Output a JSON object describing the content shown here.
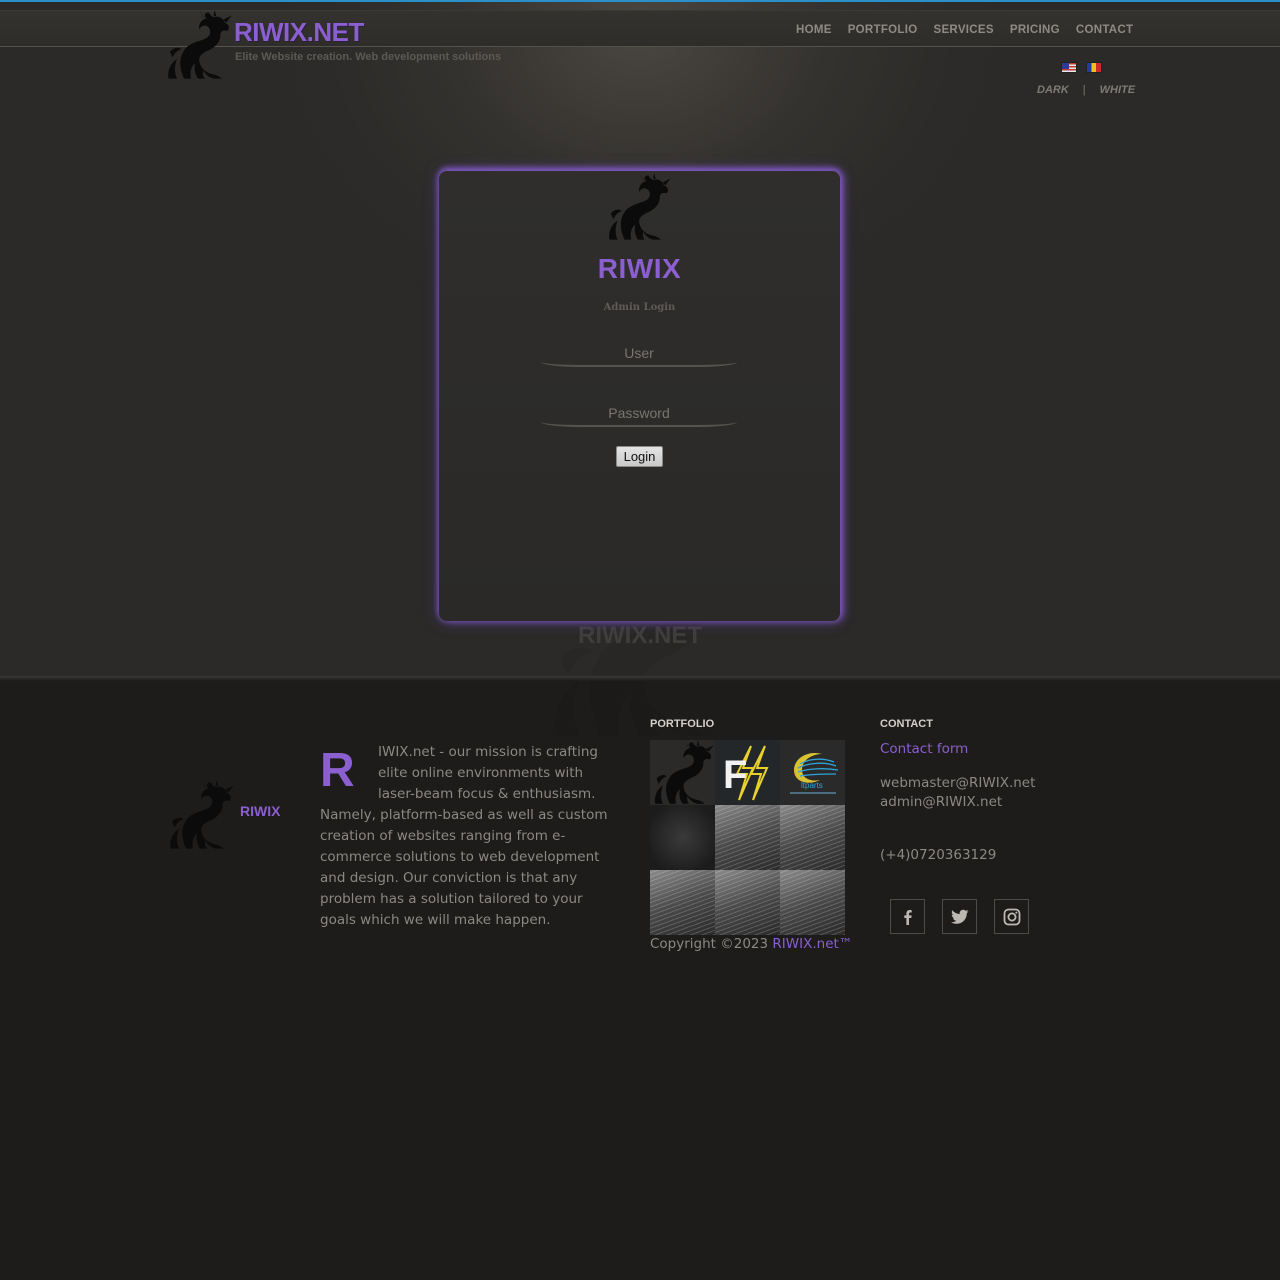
{
  "header": {
    "brand_title": "RIWIX.NET",
    "tagline": "Elite Website creation. Web development solutions",
    "nav": [
      {
        "label": "HOME"
      },
      {
        "label": "PORTFOLIO"
      },
      {
        "label": "SERVICES"
      },
      {
        "label": "PRICING"
      },
      {
        "label": "CONTACT"
      }
    ],
    "languages": [
      "english-flag-icon",
      "romanian-flag-icon"
    ],
    "theme": {
      "dark": "DARK",
      "separator": "|",
      "white": "WHITE"
    }
  },
  "login": {
    "brand": "RIWIX",
    "subtitle": "Admin Login",
    "user_placeholder": "User",
    "password_placeholder": "Password",
    "button_label": "Login"
  },
  "watermark": {
    "text": "RIWIX.NET"
  },
  "footer": {
    "logo_text": "RIWIX",
    "about": {
      "dropcap": "R",
      "text": "IWIX.net - our mission is crafting elite online environments with laser-beam focus & enthusiasm. Namely, platform-based as well as custom creation of websites ranging from e-commerce solutions to web development and design. Our conviction is that any problem has a solution tailored to your goals which we will make happen."
    },
    "portfolio": {
      "heading": "PORTFOLIO",
      "tiles": [
        {
          "letter": "",
          "caption": ""
        },
        {
          "letter": "F",
          "caption": ""
        },
        {
          "letter": "",
          "caption": "ltparts"
        },
        {
          "letter": "",
          "caption": ""
        },
        {
          "letter": "",
          "caption": ""
        },
        {
          "letter": "",
          "caption": ""
        },
        {
          "letter": "",
          "caption": ""
        },
        {
          "letter": "",
          "caption": ""
        },
        {
          "letter": "",
          "caption": ""
        }
      ]
    },
    "copyright": {
      "prefix": "Copyright ©2023",
      "brand": "RIWIX.net™"
    },
    "contact": {
      "heading": "CONTACT",
      "form_link": "Contact form",
      "email1": "webmaster@RIWIX.net",
      "email2": "admin@RIWIX.net",
      "phone": "(+4)0720363129",
      "social": [
        "facebook-icon",
        "twitter-icon",
        "instagram-icon"
      ]
    }
  },
  "colors": {
    "accent": "#8b5fd0",
    "top_accent": "#2d8fc9",
    "background": "#1d1c1b"
  }
}
